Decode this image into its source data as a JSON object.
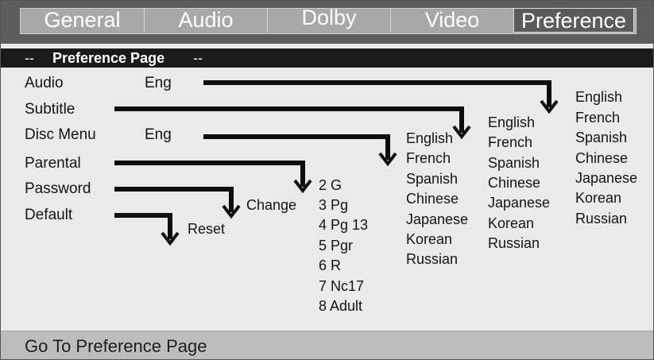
{
  "tabs": [
    {
      "label": "General"
    },
    {
      "label": "Audio"
    },
    {
      "label": "Dolby"
    },
    {
      "label": "Video"
    },
    {
      "label": "Preference",
      "active": true
    }
  ],
  "header": {
    "prefix": "--",
    "title": "Preference Page",
    "suffix": "--"
  },
  "menu": {
    "audio": {
      "label": "Audio",
      "value": "Eng"
    },
    "subtitle": {
      "label": "Subtitle"
    },
    "disc_menu": {
      "label": "Disc Menu",
      "value": "Eng"
    },
    "parental": {
      "label": "Parental"
    },
    "password": {
      "label": "Password"
    },
    "default": {
      "label": "Default"
    }
  },
  "submenus": {
    "password_action": "Change",
    "default_action": "Reset",
    "parental_options": [
      "2 G",
      "3 Pg",
      "4 Pg 13",
      "5 Pgr",
      "6 R",
      "7 Nc17",
      "8 Adult"
    ],
    "disc_menu_languages": [
      "English",
      "French",
      "Spanish",
      "Chinese",
      "Japanese",
      "Korean",
      "Russian"
    ],
    "subtitle_languages": [
      "English",
      "French",
      "Spanish",
      "Chinese",
      "Japanese",
      "Korean",
      "Russian"
    ],
    "audio_languages": [
      "English",
      "French",
      "Spanish",
      "Chinese",
      "Japanese",
      "Korean",
      "Russian"
    ]
  },
  "footer": {
    "status": "Go To Preference Page"
  },
  "colors": {
    "panel_background": "#eaeaea",
    "tab_bar": "#5d5d5d",
    "active_tab": "#5b5b5b",
    "header_bar": "#1a1a1a",
    "footer_bar": "#bdbdbd"
  }
}
